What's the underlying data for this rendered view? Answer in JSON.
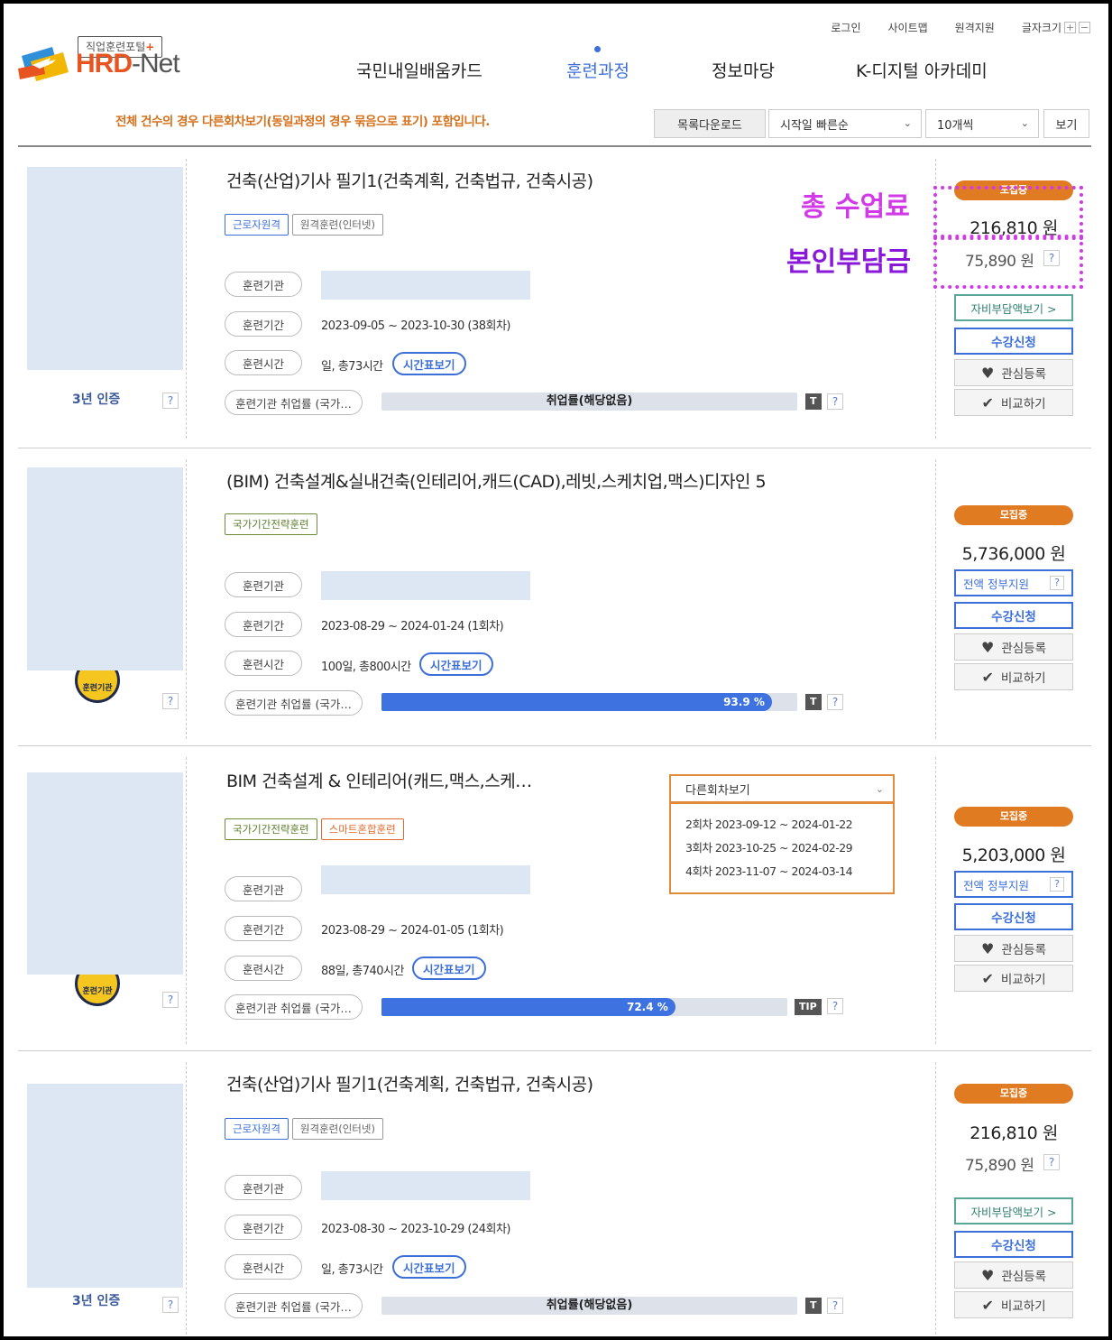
{
  "header": {
    "logo": {
      "tagline_text": "직업훈련포털",
      "tagline_plus": "+",
      "name_main": "HRD",
      "name_dash": "-",
      "name_net": "Net"
    },
    "util_links": [
      "로그인",
      "사이트맵",
      "원격지원",
      "글자크기"
    ],
    "font_plus": "+",
    "font_minus": "−",
    "nav": [
      "국민내일배움카드",
      "훈련과정",
      "정보마당",
      "K-디지털 아카데미"
    ],
    "active_nav_index": 1
  },
  "toolbar": {
    "notice": "전체 건수의 경우 다른회차보기(동일과정의 경우 묶음으로 표기) 포함입니다.",
    "download_label": "목록다운로드",
    "sort_value": "시작일 빠른순",
    "count_value": "10개씩",
    "view_label": "보기"
  },
  "labels": {
    "institution": "훈련기관",
    "period": "훈련기간",
    "hours": "훈련시간",
    "employment": "훈련기관 취업률 (국가…",
    "timetable": "시간표보기",
    "help": "?",
    "tip_t": "T",
    "tip_tip": "TIP",
    "status": "모집중",
    "apply": "수강신청",
    "favorite": "관심등록",
    "compare": "비교하기",
    "self_burden": "자비부담액보기 >",
    "gov_support": "전액 정부지원",
    "emblem": "훈련기관"
  },
  "courses": [
    {
      "cert": "3년 인증",
      "title": "건축(산업)기사 필기1(건축계획, 건축법규, 건축시공)",
      "tags": [
        {
          "label": "근로자원격",
          "style": "blue"
        },
        {
          "label": "원격훈련(인터넷)",
          "style": "gray"
        }
      ],
      "period": "2023-09-05 ~ 2023-10-30 (38회차)",
      "hours": "일, 총73시간",
      "employment_text": "취업률(해당없음)",
      "employment_rate": null,
      "status": "모집중",
      "total_fee": "216,810 원",
      "self_pay": "75,890 원"
    },
    {
      "cert": "",
      "title": "(BIM) 건축설계&실내건축(인테리어,캐드(CAD),레빗,스케치업,맥스)디자인 5",
      "tags": [
        {
          "label": "국가기간전략훈련",
          "style": "green"
        }
      ],
      "period": "2023-08-29 ~ 2024-01-24 (1회차)",
      "hours": "100일, 총800시간",
      "employment_text": "93.9 %",
      "employment_rate": 93.9,
      "status": "모집중",
      "total_fee": "5,736,000 원",
      "self_pay": ""
    },
    {
      "cert": "",
      "title": "BIM 건축설계 & 인테리어(캐드,맥스,스케…",
      "tags": [
        {
          "label": "국가기간전략훈련",
          "style": "green"
        },
        {
          "label": "스마트혼합훈련",
          "style": "orange"
        }
      ],
      "period": "2023-08-29 ~ 2024-01-05 (1회차)",
      "hours": "88일, 총740시간",
      "employment_text": "72.4 %",
      "employment_rate": 72.4,
      "status": "모집중",
      "total_fee": "5,203,000 원",
      "self_pay": "",
      "other_sessions": {
        "label": "다른회차보기",
        "items": [
          "2회차 2023-09-12 ~ 2024-01-22",
          "3회차 2023-10-25 ~ 2024-02-29",
          "4회차 2023-11-07 ~ 2024-03-14"
        ]
      }
    },
    {
      "cert": "3년 인증",
      "title": "건축(산업)기사 필기1(건축계획, 건축법규, 건축시공)",
      "tags": [
        {
          "label": "근로자원격",
          "style": "blue"
        },
        {
          "label": "원격훈련(인터넷)",
          "style": "gray"
        }
      ],
      "period": "2023-08-30 ~ 2023-10-29 (24회차)",
      "hours": "일, 총73시간",
      "employment_text": "취업률(해당없음)",
      "employment_rate": null,
      "status": "모집중",
      "total_fee": "216,810 원",
      "self_pay": "75,890 원"
    }
  ],
  "annotations": {
    "total_fee_label": "총 수업료",
    "self_pay_label": "본인부담금"
  },
  "colors": {
    "brand_orange": "#e8541f",
    "accent_blue": "#3d6fd8",
    "status_orange": "#e07b22",
    "annotation_magenta": "#d23ae8",
    "annotation_purple": "#8a18d8"
  }
}
